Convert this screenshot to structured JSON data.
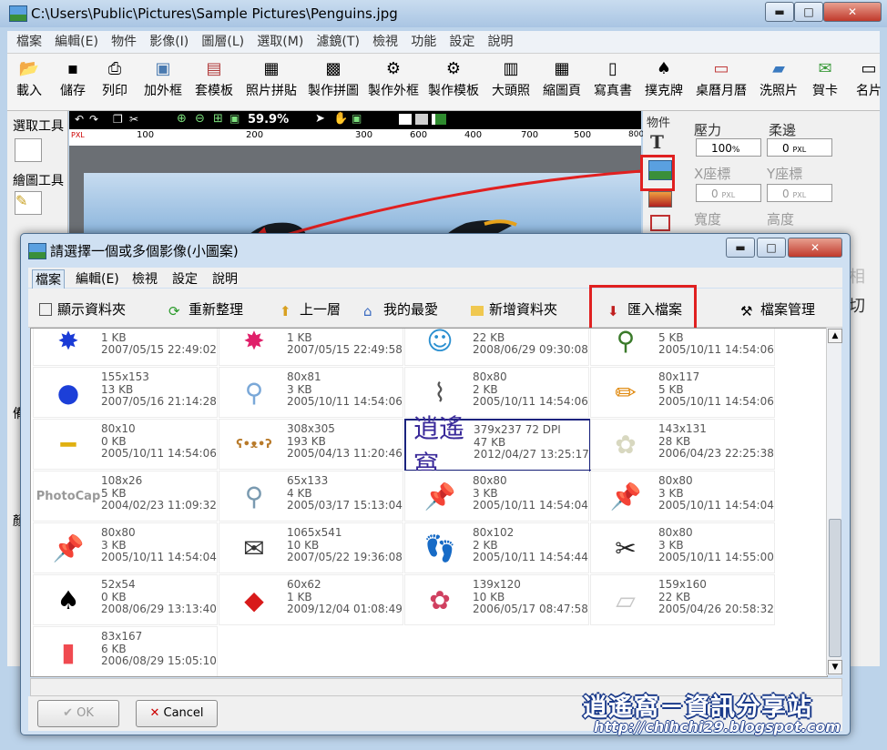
{
  "main_window": {
    "title": "C:\\Users\\Public\\Pictures\\Sample Pictures\\Penguins.jpg",
    "controls": {
      "minimize": "▬",
      "maximize": "□",
      "close": "✕"
    },
    "menu": [
      "檔案",
      "編輯(E)",
      "物件",
      "影像(I)",
      "圖層(L)",
      "選取(M)",
      "濾鏡(T)",
      "檢視",
      "功能",
      "設定",
      "說明"
    ],
    "toolbar": [
      {
        "label": "載入",
        "icon": "open-folder-icon"
      },
      {
        "label": "儲存",
        "icon": "save-disk-icon"
      },
      {
        "label": "列印",
        "icon": "printer-icon"
      },
      {
        "label": "加外框",
        "icon": "frame-icon"
      },
      {
        "label": "套模板",
        "icon": "template-icon"
      },
      {
        "label": "照片拼貼",
        "icon": "collage-icon"
      },
      {
        "label": "製作拼圖",
        "icon": "puzzle-icon"
      },
      {
        "label": "製作外框",
        "icon": "make-frame-icon"
      },
      {
        "label": "製作模板",
        "icon": "make-template-icon"
      },
      {
        "label": "大頭照",
        "icon": "id-photo-icon"
      },
      {
        "label": "縮圖頁",
        "icon": "thumbnail-page-icon"
      },
      {
        "label": "寫真書",
        "icon": "photo-book-icon"
      },
      {
        "label": "撲克牌",
        "icon": "playing-cards-icon"
      },
      {
        "label": "桌曆月曆",
        "icon": "calendar-icon"
      },
      {
        "label": "洗照片",
        "icon": "print-photo-icon"
      },
      {
        "label": "賀卡",
        "icon": "greeting-card-icon"
      },
      {
        "label": "名片",
        "icon": "business-card-icon"
      }
    ],
    "left_panel": {
      "select_tools": "選取工具",
      "paint_tools": "繪圖工具",
      "side_a": "備",
      "side_b": "顏"
    },
    "zoom": "59.9%",
    "ruler_ticks": [
      "100",
      "200",
      "300",
      "400",
      "500",
      "600",
      "700",
      "800"
    ],
    "ruler_unit": "PXL",
    "objects_label": "物件",
    "text_tool_glyph": "T",
    "properties": {
      "pressure_label": "壓力",
      "pressure_value": "100",
      "pressure_unit": "%",
      "soft_edge_label": "柔邊",
      "soft_edge_value": "0",
      "x_label": "X座標",
      "x_value": "0",
      "y_label": "Y座標",
      "y_value": "0",
      "width_label": "寬度",
      "height_label": "高度",
      "unit": "PXL",
      "extra_1": "相",
      "extra_2": "切"
    }
  },
  "dialog": {
    "title": "請選擇一個或多個影像(小圖案)",
    "controls": {
      "minimize": "▬",
      "maximize": "□",
      "close": "✕"
    },
    "menu": [
      "檔案",
      "編輯(E)",
      "檢視",
      "設定",
      "說明"
    ],
    "toolbar": [
      {
        "label": "顯示資料夾",
        "icon": "folder-tree-icon"
      },
      {
        "label": "重新整理",
        "icon": "refresh-icon"
      },
      {
        "label": "上一層",
        "icon": "up-folder-icon"
      },
      {
        "label": "我的最愛",
        "icon": "favorites-icon"
      },
      {
        "label": "新增資料夾",
        "icon": "new-folder-icon"
      },
      {
        "label": "匯入檔案",
        "icon": "import-file-icon"
      },
      {
        "label": "檔案管理",
        "icon": "wrench-icon"
      }
    ],
    "items": [
      {
        "dims": "",
        "size": "1 KB",
        "date": "2007/05/15 22:49:02",
        "thumb": "paint-splat-blue-icon",
        "glyph": "✸",
        "color": "#1a3bd6"
      },
      {
        "dims": "",
        "size": "1 KB",
        "date": "2007/05/15 22:49:58",
        "thumb": "paint-splat-pink-icon",
        "glyph": "✸",
        "color": "#e0206a"
      },
      {
        "dims": "",
        "size": "22 KB",
        "date": "2008/06/29 09:30:08",
        "thumb": "cartoon-figure-icon",
        "glyph": "☺",
        "color": "#2a8fd0"
      },
      {
        "dims": "",
        "size": "5 KB",
        "date": "2005/10/11 14:54:06",
        "thumb": "magnifier-icon",
        "glyph": "⚲",
        "color": "#3a7a2a"
      },
      {
        "dims": "155x153",
        "size": "13 KB",
        "date": "2007/05/16 21:14:28",
        "thumb": "blue-ball-icon",
        "glyph": "●",
        "color": "#1c3fd8"
      },
      {
        "dims": "80x81",
        "size": "3 KB",
        "date": "2005/10/11 14:54:06",
        "thumb": "magnifier-icon",
        "glyph": "⚲",
        "color": "#7aa8d8"
      },
      {
        "dims": "80x80",
        "size": "2 KB",
        "date": "2005/10/11 14:54:06",
        "thumb": "paperclip-icon",
        "glyph": "⌇",
        "color": "#555"
      },
      {
        "dims": "80x117",
        "size": "5 KB",
        "date": "2005/10/11 14:54:06",
        "thumb": "pencil-icon",
        "glyph": "✏",
        "color": "#e08a10"
      },
      {
        "dims": "80x10",
        "size": "0 KB",
        "date": "2005/10/11 14:54:06",
        "thumb": "pencil-icon",
        "glyph": "━",
        "color": "#e0b010"
      },
      {
        "dims": "308x305",
        "size": "193 KB",
        "date": "2005/04/13 11:20:46",
        "thumb": "teddy-bear-icon",
        "glyph": "ʕ•ᴥ•ʔ",
        "color": "#b87a2a"
      },
      {
        "dims": "379x237 72 DPI",
        "size": "47 KB",
        "date": "2012/04/27 13:25:17",
        "thumb": "blog-logo-icon",
        "glyph": "逍遙窩",
        "color": "#3a2a9a",
        "selected": true
      },
      {
        "dims": "143x131",
        "size": "28 KB",
        "date": "2006/04/23 22:25:38",
        "thumb": "white-flower-icon",
        "glyph": "✿",
        "color": "#d8d8c0"
      },
      {
        "dims": "108x26",
        "size": "5 KB",
        "date": "2004/02/23 11:09:32",
        "thumb": "photocap-logo-icon",
        "glyph": "PhotoCap",
        "color": "#999"
      },
      {
        "dims": "65x133",
        "size": "4 KB",
        "date": "2005/03/17 15:13:04",
        "thumb": "pin-icon",
        "glyph": "⚲",
        "color": "#7a9ab0"
      },
      {
        "dims": "80x80",
        "size": "3 KB",
        "date": "2005/10/11 14:54:04",
        "thumb": "pushpin-blue-icon",
        "glyph": "📌",
        "color": "#1a3ad0"
      },
      {
        "dims": "80x80",
        "size": "3 KB",
        "date": "2005/10/11 14:54:04",
        "thumb": "pushpin-green-icon",
        "glyph": "📌",
        "color": "#1a8a3a"
      },
      {
        "dims": "80x80",
        "size": "3 KB",
        "date": "2005/10/11 14:54:04",
        "thumb": "pushpin-yellow-icon",
        "glyph": "📌",
        "color": "#e0c020"
      },
      {
        "dims": "1065x541",
        "size": "10 KB",
        "date": "2007/05/22 19:36:08",
        "thumb": "postmark-stamp-icon",
        "glyph": "✉",
        "color": "#333"
      },
      {
        "dims": "80x102",
        "size": "2 KB",
        "date": "2005/10/11 14:54:44",
        "thumb": "footprint-icon",
        "glyph": "👣",
        "color": "#111"
      },
      {
        "dims": "80x80",
        "size": "3 KB",
        "date": "2005/10/11 14:55:00",
        "thumb": "scissors-icon",
        "glyph": "✂",
        "color": "#222"
      },
      {
        "dims": "52x54",
        "size": "0 KB",
        "date": "2008/06/29 13:13:40",
        "thumb": "spade-icon",
        "glyph": "♠",
        "color": "#000"
      },
      {
        "dims": "60x62",
        "size": "1 KB",
        "date": "2009/12/04 01:08:49",
        "thumb": "spring-couplet-icon",
        "glyph": "◆",
        "color": "#d81a1a"
      },
      {
        "dims": "139x120",
        "size": "10 KB",
        "date": "2006/05/17 08:47:58",
        "thumb": "round-photo-frame-icon",
        "glyph": "✿",
        "color": "#d04060"
      },
      {
        "dims": "159x160",
        "size": "22 KB",
        "date": "2005/04/26 20:58:32",
        "thumb": "tape-strip-icon",
        "glyph": "▱",
        "color": "#c8c8c8"
      },
      {
        "dims": "83x167",
        "size": "6 KB",
        "date": "2006/08/29 15:05:10",
        "thumb": "red-tape-icon",
        "glyph": "▮",
        "color": "#f04a50"
      }
    ],
    "ok_label": "OK",
    "cancel_label": "Cancel"
  },
  "watermark": {
    "line1": "逍遙窩－資訊分享站",
    "line2": "http://chihchi29.blogspot.com"
  },
  "colors": {
    "highlight_red": "#e02020",
    "selection_navy": "#1a237e"
  }
}
